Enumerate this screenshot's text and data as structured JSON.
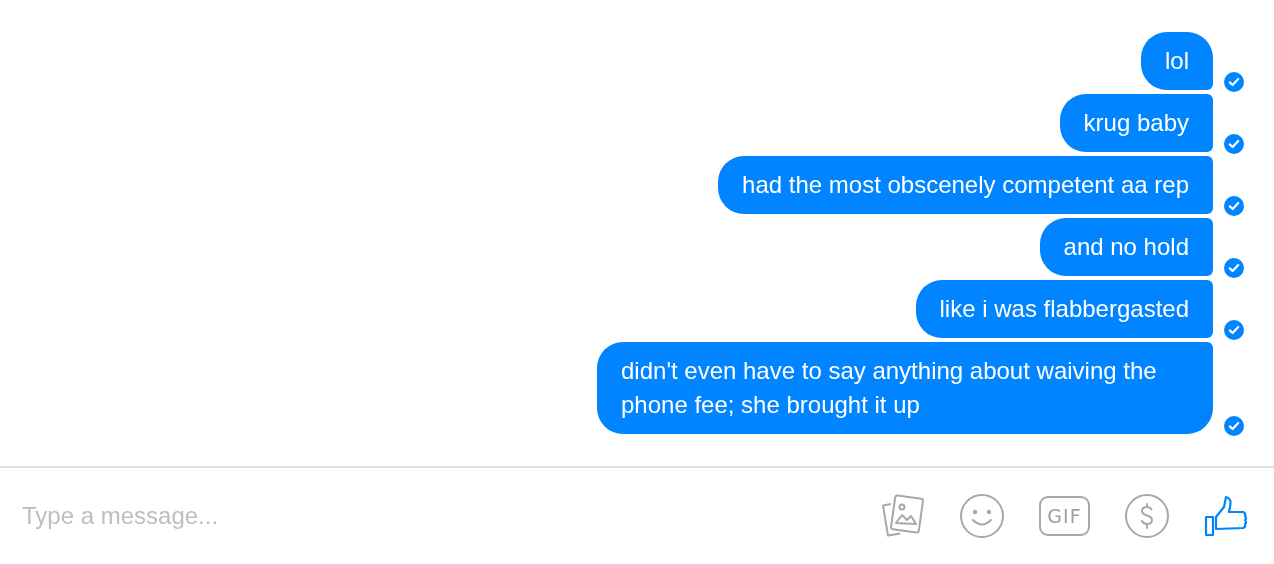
{
  "messages": [
    {
      "text": "lol",
      "delivered": true
    },
    {
      "text": "krug baby",
      "delivered": true
    },
    {
      "text": "had the most obscenely competent aa rep",
      "delivered": true
    },
    {
      "text": "and no hold",
      "delivered": true
    },
    {
      "text": "like i was flabbergasted",
      "delivered": true
    },
    {
      "text": "didn't even have to say anything about waiving the phone fee; she brought it up",
      "delivered": true
    }
  ],
  "composer": {
    "placeholder": "Type a message...",
    "gif_label": "GIF"
  }
}
